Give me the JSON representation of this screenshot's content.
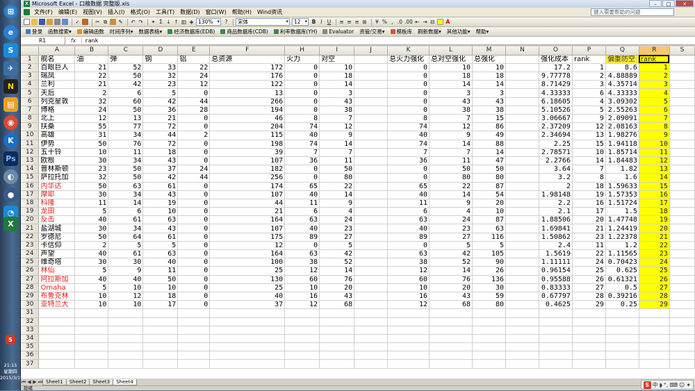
{
  "window": {
    "title": "Microsoft Excel - 口粮数据 完整版.xls",
    "app_icon": "excel-icon"
  },
  "menubar": {
    "items": [
      "文件(F)",
      "编辑(E)",
      "视图(V)",
      "插入(I)",
      "格式(O)",
      "工具(T)",
      "数据(D)",
      "窗口(W)",
      "帮助(H)",
      "Wind资讯"
    ],
    "help_placeholder": "键入需要帮助的问题"
  },
  "toolbar": {
    "zoom": "130%",
    "font": "宋体",
    "font_size": "12"
  },
  "toolbar2": {
    "items": [
      "登录",
      "函数搜索▾",
      "编辑函数",
      "时间序列▾",
      "数据表格▾",
      "经济数据库(EDB)",
      "商品数据库(CDB)",
      "利率数据库(YH)",
      "Evaluator",
      "资管/交易▾",
      "模板库",
      "刷新数据▾",
      "其他功能▾",
      "帮助▾"
    ]
  },
  "formula_bar": {
    "name_box": "R1",
    "fx": "fx",
    "content": "rank"
  },
  "columns": [
    "A",
    "B",
    "C",
    "D",
    "E",
    "F",
    "H",
    "I",
    "J",
    "K",
    "L",
    "M",
    "N",
    "O",
    "P",
    "Q",
    "R",
    "S"
  ],
  "header_row": [
    "舰名",
    "油",
    "弹",
    "钢",
    "铝",
    "总资源",
    "火力",
    "对空",
    "",
    "总火力强化",
    "总对空强化",
    "总强化",
    "",
    "强化成本",
    "rank",
    "偏重防空",
    "rank",
    ""
  ],
  "rows": [
    [
      "百眼巨人",
      "21",
      "52",
      "33",
      "22",
      "172",
      "0",
      "10",
      "",
      "0",
      "10",
      "10",
      "",
      "17.2",
      "1",
      "8.6",
      "1"
    ],
    [
      "瑞凤",
      "22",
      "50",
      "32",
      "24",
      "176",
      "0",
      "18",
      "",
      "0",
      "18",
      "18",
      "",
      "9.77778",
      "2",
      "4.88889",
      "2"
    ],
    [
      "兰利",
      "21",
      "42",
      "23",
      "12",
      "122",
      "0",
      "14",
      "",
      "0",
      "14",
      "14",
      "",
      "8.71429",
      "3",
      "4.35714",
      "3"
    ],
    [
      "天后",
      "2",
      "6",
      "5",
      "0",
      "13",
      "0",
      "3",
      "",
      "0",
      "3",
      "3",
      "",
      "4.33333",
      "6",
      "4.33333",
      "4"
    ],
    [
      "列克星敦",
      "32",
      "60",
      "42",
      "44",
      "266",
      "0",
      "43",
      "",
      "0",
      "43",
      "43",
      "",
      "6.18605",
      "4",
      "3.09302",
      "5"
    ],
    [
      "博格",
      "24",
      "50",
      "36",
      "28",
      "194",
      "0",
      "38",
      "",
      "0",
      "38",
      "38",
      "",
      "5.10526",
      "5",
      "2.55263",
      "6"
    ],
    [
      "北上",
      "12",
      "13",
      "21",
      "0",
      "46",
      "8",
      "7",
      "",
      "8",
      "7",
      "15",
      "",
      "3.06667",
      "9",
      "2.09091",
      "7"
    ],
    [
      "扶桑",
      "55",
      "77",
      "72",
      "0",
      "204",
      "74",
      "12",
      "",
      "74",
      "12",
      "86",
      "",
      "2.37209",
      "12",
      "2.08163",
      "8"
    ],
    [
      "高雄",
      "31",
      "34",
      "44",
      "2",
      "115",
      "40",
      "9",
      "",
      "40",
      "9",
      "49",
      "",
      "2.34694",
      "13",
      "1.98276",
      "9"
    ],
    [
      "伊势",
      "50",
      "76",
      "72",
      "0",
      "198",
      "74",
      "14",
      "",
      "74",
      "14",
      "88",
      "",
      "2.25",
      "15",
      "1.94118",
      "10"
    ],
    [
      "五十铃",
      "10",
      "11",
      "18",
      "0",
      "39",
      "7",
      "7",
      "",
      "7",
      "7",
      "14",
      "",
      "2.78571",
      "10",
      "1.85714",
      "11"
    ],
    [
      "欧根",
      "30",
      "34",
      "43",
      "0",
      "107",
      "36",
      "11",
      "",
      "36",
      "11",
      "47",
      "",
      "2.2766",
      "14",
      "1.84483",
      "12"
    ],
    [
      "普林斯顿",
      "23",
      "50",
      "37",
      "24",
      "182",
      "0",
      "50",
      "",
      "0",
      "50",
      "50",
      "",
      "3.64",
      "7",
      "1.82",
      "13"
    ],
    [
      "萨拉托加",
      "32",
      "50",
      "42",
      "44",
      "256",
      "0",
      "80",
      "",
      "0",
      "80",
      "80",
      "",
      "3.2",
      "8",
      "1.6",
      "14"
    ],
    [
      "内华达",
      "50",
      "63",
      "61",
      "0",
      "174",
      "65",
      "22",
      "",
      "65",
      "22",
      "87",
      "",
      "2",
      "18",
      "1.59633",
      "15"
    ],
    [
      "摩耶",
      "30",
      "34",
      "43",
      "0",
      "107",
      "40",
      "14",
      "",
      "40",
      "14",
      "54",
      "",
      "1.98148",
      "19",
      "1.57353",
      "16"
    ],
    [
      "科隆",
      "11",
      "14",
      "19",
      "0",
      "44",
      "11",
      "9",
      "",
      "11",
      "9",
      "20",
      "",
      "2.2",
      "16",
      "1.51724",
      "17"
    ],
    [
      "龙田",
      "5",
      "6",
      "10",
      "0",
      "21",
      "6",
      "4",
      "",
      "6",
      "4",
      "10",
      "",
      "2.1",
      "17",
      "1.5",
      "18"
    ],
    [
      "反击",
      "40",
      "61",
      "63",
      "0",
      "164",
      "63",
      "24",
      "",
      "63",
      "24",
      "87",
      "",
      "1.88506",
      "20",
      "1.47748",
      "19"
    ],
    [
      "盐湖城",
      "30",
      "34",
      "43",
      "0",
      "107",
      "40",
      "23",
      "",
      "40",
      "23",
      "63",
      "",
      "1.69841",
      "21",
      "1.24419",
      "20"
    ],
    [
      "罗德尼",
      "50",
      "64",
      "61",
      "0",
      "175",
      "89",
      "27",
      "",
      "89",
      "27",
      "116",
      "",
      "1.50862",
      "23",
      "1.22378",
      "21"
    ],
    [
      "卡信仰",
      "2",
      "5",
      "5",
      "0",
      "12",
      "0",
      "5",
      "",
      "0",
      "5",
      "5",
      "",
      "2.4",
      "11",
      "1.2",
      "22"
    ],
    [
      "声望",
      "40",
      "61",
      "63",
      "0",
      "164",
      "63",
      "42",
      "",
      "63",
      "42",
      "105",
      "",
      "1.5619",
      "22",
      "1.11565",
      "23"
    ],
    [
      "维奇塔",
      "30",
      "30",
      "40",
      "0",
      "100",
      "38",
      "52",
      "",
      "38",
      "52",
      "90",
      "",
      "1.11111",
      "24",
      "0.70423",
      "24"
    ],
    [
      "林仙",
      "5",
      "9",
      "11",
      "0",
      "25",
      "12",
      "14",
      "",
      "12",
      "14",
      "26",
      "",
      "0.96154",
      "25",
      "0.625",
      "25"
    ],
    [
      "阿拉斯加",
      "40",
      "40",
      "50",
      "0",
      "130",
      "60",
      "76",
      "",
      "60",
      "76",
      "136",
      "",
      "0.95588",
      "26",
      "0.61321",
      "26"
    ],
    [
      "Omaha",
      "5",
      "10",
      "10",
      "0",
      "25",
      "10",
      "20",
      "",
      "10",
      "20",
      "30",
      "",
      "0.83333",
      "27",
      "0.5",
      "27"
    ],
    [
      "布鲁克林",
      "10",
      "12",
      "18",
      "0",
      "40",
      "16",
      "43",
      "",
      "16",
      "43",
      "59",
      "",
      "0.67797",
      "28",
      "0.39216",
      "28"
    ],
    [
      "亚特兰大",
      "10",
      "10",
      "17",
      "0",
      "37",
      "12",
      "68",
      "",
      "12",
      "68",
      "80",
      "",
      "0.4625",
      "29",
      "0.25",
      "29"
    ]
  ],
  "red_names": [
    "内华达",
    "摩耶",
    "科隆",
    "龙田",
    "反击",
    "林仙",
    "阿拉斯加",
    "Omaha",
    "布鲁克林",
    "亚特兰大"
  ],
  "empty_rows": [
    "31",
    "32",
    "33",
    "34",
    "35",
    "36",
    "37"
  ],
  "sheet_tabs": [
    "Sheet1",
    "Sheet2",
    "Sheet3",
    "Sheet4"
  ],
  "active_tab": "Sheet4",
  "status": "就绪",
  "clock": {
    "time": "21:15",
    "weekday": "星期四",
    "date": "2015/3/19"
  },
  "colors": {
    "highlight": "#ffff00",
    "red_text": "#e02020",
    "selected_header": "#f9c86a"
  }
}
